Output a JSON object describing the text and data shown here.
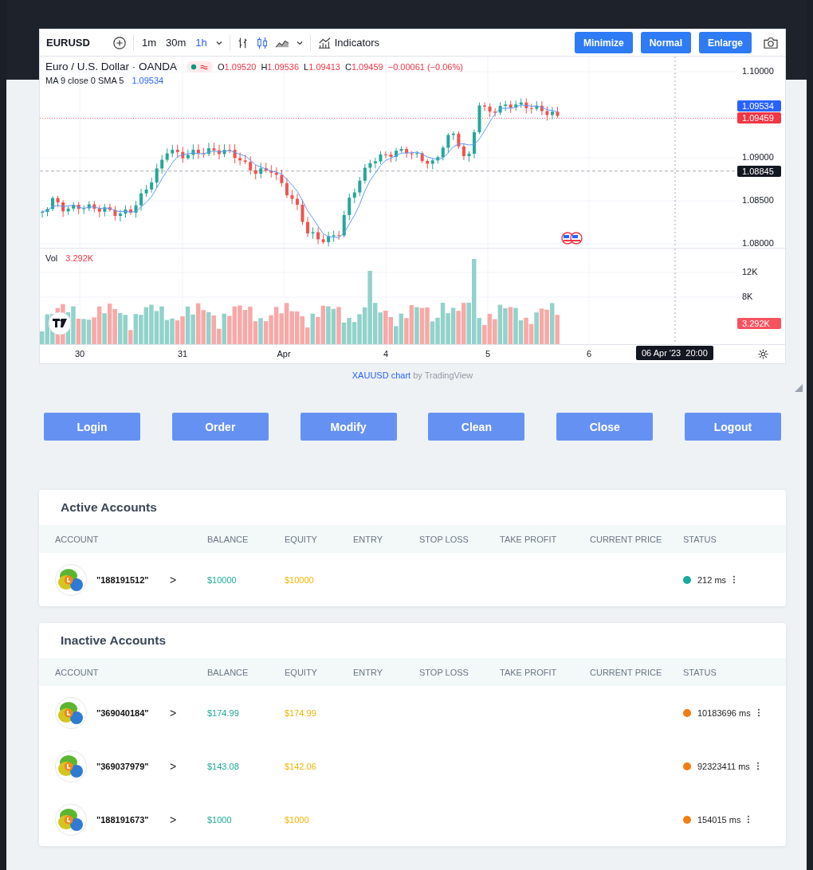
{
  "chart": {
    "symbol": "EURUSD",
    "intervals": [
      {
        "label": "1m",
        "selected": false
      },
      {
        "label": "30m",
        "selected": false
      },
      {
        "label": "1h",
        "selected": true
      }
    ],
    "indicators_label": "Indicators",
    "window_buttons": [
      "Minimize",
      "Normal",
      "Enlarge"
    ],
    "title": "Euro / U.S. Dollar · OANDA",
    "ohlc": [
      {
        "key": "O",
        "value": "1.09520"
      },
      {
        "key": "H",
        "value": "1.09536"
      },
      {
        "key": "L",
        "value": "1.09413"
      },
      {
        "key": "C",
        "value": "1.09459"
      }
    ],
    "change": "−0.00061 (−0.06%)",
    "ma_label": "MA 9 close 0 SMA 5",
    "ma_value": "1.09534",
    "price_ticks": [
      "1.10000",
      "1.09000",
      "1.08500",
      "1.08000"
    ],
    "price_tags": [
      {
        "text": "1.09534",
        "color": "#2962ff"
      },
      {
        "text": "1.09459",
        "color": "#f23645"
      },
      {
        "text": "1.08845",
        "color": "#131722"
      }
    ],
    "volume_label": "Vol",
    "volume_value": "3.292K",
    "volume_ticks": [
      "12K",
      "8K"
    ],
    "volume_tag": "3.292K",
    "time_ticks": [
      "30",
      "31",
      "Apr",
      "4",
      "5",
      "6"
    ],
    "crosshair_time": "06 Apr '23  20:00"
  },
  "attribution": {
    "link": "XAUUSD chart",
    "suffix": "by TradingView"
  },
  "actions": [
    "Login",
    "Order",
    "Modify",
    "Clean",
    "Close",
    "Logout"
  ],
  "tables": [
    {
      "title": "Active Accounts",
      "columns": [
        "ACCOUNT",
        "BALANCE",
        "EQUITY",
        "ENTRY",
        "STOP LOSS",
        "TAKE PROFIT",
        "CURRENT PRICE",
        "STATUS"
      ],
      "rows": [
        {
          "account": "\"188191512\"",
          "arrow": ">",
          "balance": "$10000",
          "equity": "$10000",
          "color": "#1aa99a",
          "latency": "212 ms"
        }
      ]
    },
    {
      "title": "Inactive Accounts",
      "columns": [
        "ACCOUNT",
        "BALANCE",
        "EQUITY",
        "ENTRY",
        "STOP LOSS",
        "TAKE PROFIT",
        "CURRENT PRICE",
        "STATUS"
      ],
      "rows": [
        {
          "account": "\"369040184\"",
          "arrow": ">",
          "balance": "$174.99",
          "equity": "$174.99",
          "color": "#f57c12",
          "latency": "10183696 ms"
        },
        {
          "account": "\"369037979\"",
          "arrow": ">",
          "balance": "$143.08",
          "equity": "$142.06",
          "color": "#f57c12",
          "latency": "92323411 ms"
        },
        {
          "account": "\"188191673\"",
          "arrow": ">",
          "balance": "$1000",
          "equity": "$1000",
          "color": "#f57c12",
          "latency": "154015 ms"
        }
      ]
    }
  ]
}
